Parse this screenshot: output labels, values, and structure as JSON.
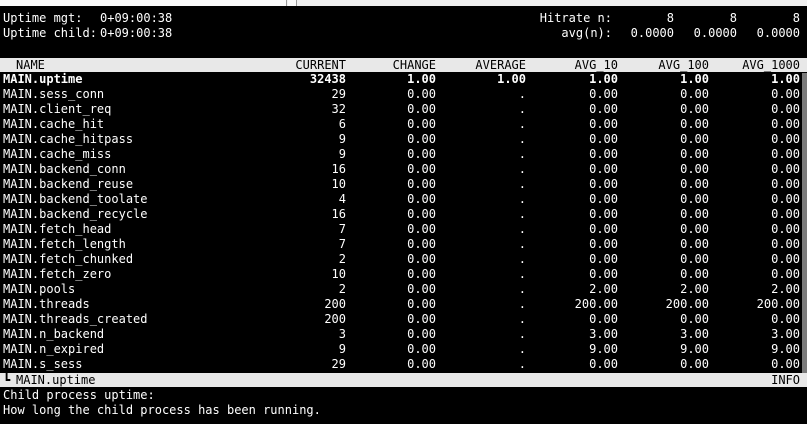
{
  "header": {
    "uptime_mgt_label": "Uptime mgt:",
    "uptime_mgt_value": "0+09:00:38",
    "uptime_child_label": "Uptime child:",
    "uptime_child_value": "0+09:00:38",
    "hitrate_label": "Hitrate n:",
    "hitrate_values": [
      "8",
      "8",
      "8"
    ],
    "avg_label": "avg(n):",
    "avg_values": [
      "0.0000",
      "0.0000",
      "0.0000"
    ]
  },
  "columns": {
    "name": "NAME",
    "current": "CURRENT",
    "change": "CHANGE",
    "average": "AVERAGE",
    "avg10": "AVG_10",
    "avg100": "AVG_100",
    "avg1000": "AVG_1000"
  },
  "rows": [
    {
      "name": "MAIN.uptime",
      "current": "32438",
      "change": "1.00",
      "average": "1.00",
      "avg10": "1.00",
      "avg100": "1.00",
      "avg1000": "1.00",
      "bold": true
    },
    {
      "name": "MAIN.sess_conn",
      "current": "29",
      "change": "0.00",
      "average": ".",
      "avg10": "0.00",
      "avg100": "0.00",
      "avg1000": "0.00"
    },
    {
      "name": "MAIN.client_req",
      "current": "32",
      "change": "0.00",
      "average": ".",
      "avg10": "0.00",
      "avg100": "0.00",
      "avg1000": "0.00"
    },
    {
      "name": "MAIN.cache_hit",
      "current": "6",
      "change": "0.00",
      "average": ".",
      "avg10": "0.00",
      "avg100": "0.00",
      "avg1000": "0.00"
    },
    {
      "name": "MAIN.cache_hitpass",
      "current": "9",
      "change": "0.00",
      "average": ".",
      "avg10": "0.00",
      "avg100": "0.00",
      "avg1000": "0.00"
    },
    {
      "name": "MAIN.cache_miss",
      "current": "9",
      "change": "0.00",
      "average": ".",
      "avg10": "0.00",
      "avg100": "0.00",
      "avg1000": "0.00"
    },
    {
      "name": "MAIN.backend_conn",
      "current": "16",
      "change": "0.00",
      "average": ".",
      "avg10": "0.00",
      "avg100": "0.00",
      "avg1000": "0.00"
    },
    {
      "name": "MAIN.backend_reuse",
      "current": "10",
      "change": "0.00",
      "average": ".",
      "avg10": "0.00",
      "avg100": "0.00",
      "avg1000": "0.00"
    },
    {
      "name": "MAIN.backend_toolate",
      "current": "4",
      "change": "0.00",
      "average": ".",
      "avg10": "0.00",
      "avg100": "0.00",
      "avg1000": "0.00"
    },
    {
      "name": "MAIN.backend_recycle",
      "current": "16",
      "change": "0.00",
      "average": ".",
      "avg10": "0.00",
      "avg100": "0.00",
      "avg1000": "0.00"
    },
    {
      "name": "MAIN.fetch_head",
      "current": "7",
      "change": "0.00",
      "average": ".",
      "avg10": "0.00",
      "avg100": "0.00",
      "avg1000": "0.00"
    },
    {
      "name": "MAIN.fetch_length",
      "current": "7",
      "change": "0.00",
      "average": ".",
      "avg10": "0.00",
      "avg100": "0.00",
      "avg1000": "0.00"
    },
    {
      "name": "MAIN.fetch_chunked",
      "current": "2",
      "change": "0.00",
      "average": ".",
      "avg10": "0.00",
      "avg100": "0.00",
      "avg1000": "0.00"
    },
    {
      "name": "MAIN.fetch_zero",
      "current": "10",
      "change": "0.00",
      "average": ".",
      "avg10": "0.00",
      "avg100": "0.00",
      "avg1000": "0.00"
    },
    {
      "name": "MAIN.pools",
      "current": "2",
      "change": "0.00",
      "average": ".",
      "avg10": "2.00",
      "avg100": "2.00",
      "avg1000": "2.00"
    },
    {
      "name": "MAIN.threads",
      "current": "200",
      "change": "0.00",
      "average": ".",
      "avg10": "200.00",
      "avg100": "200.00",
      "avg1000": "200.00"
    },
    {
      "name": "MAIN.threads_created",
      "current": "200",
      "change": "0.00",
      "average": ".",
      "avg10": "0.00",
      "avg100": "0.00",
      "avg1000": "0.00"
    },
    {
      "name": "MAIN.n_backend",
      "current": "3",
      "change": "0.00",
      "average": ".",
      "avg10": "3.00",
      "avg100": "3.00",
      "avg1000": "3.00"
    },
    {
      "name": "MAIN.n_expired",
      "current": "9",
      "change": "0.00",
      "average": ".",
      "avg10": "9.00",
      "avg100": "9.00",
      "avg1000": "9.00"
    },
    {
      "name": "MAIN.s_sess",
      "current": "29",
      "change": "0.00",
      "average": ".",
      "avg10": "0.00",
      "avg100": "0.00",
      "avg1000": "0.00"
    }
  ],
  "status": {
    "marker": "┗",
    "selected": "MAIN.uptime",
    "level": "INFO"
  },
  "description": {
    "title": "Child process uptime:",
    "text": "How long the child process has been running."
  }
}
